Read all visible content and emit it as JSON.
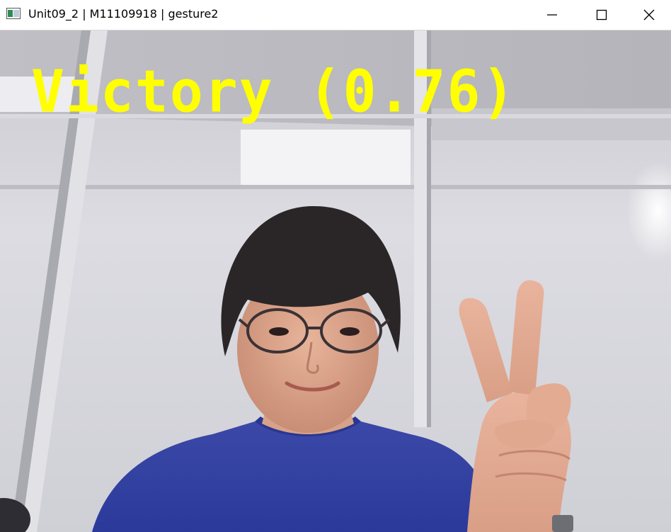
{
  "window": {
    "title": "Unit09_2 | M11109918 | gesture2",
    "icon": "opencv-window-icon",
    "controls": [
      "minimize-icon",
      "maximize-icon",
      "close-icon"
    ]
  },
  "overlay": {
    "label": "Victory (0.76)",
    "color": "#ffff00"
  }
}
